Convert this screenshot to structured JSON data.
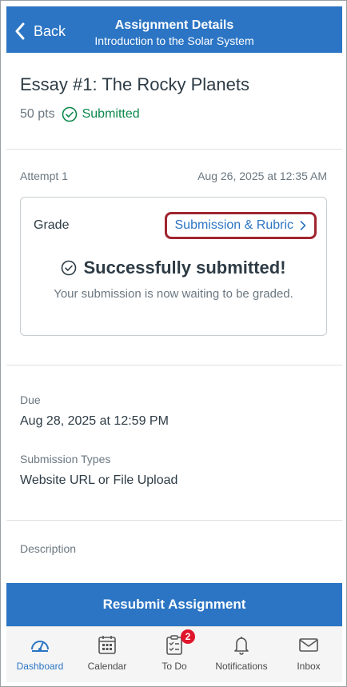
{
  "header": {
    "back_label": "Back",
    "title": "Assignment Details",
    "subtitle": "Introduction to the Solar System"
  },
  "assignment": {
    "title": "Essay #1: The Rocky Planets",
    "points": "50 pts",
    "status": "Submitted"
  },
  "attempt": {
    "label": "Attempt 1",
    "date": "Aug 26, 2025 at 12:35 AM"
  },
  "grade_card": {
    "label": "Grade",
    "link": "Submission & Rubric",
    "success_title": "Successfully submitted!",
    "success_message": "Your submission is now waiting to be graded."
  },
  "details": {
    "due_label": "Due",
    "due_value": "Aug 28, 2025 at 12:59 PM",
    "types_label": "Submission Types",
    "types_value": "Website URL or File Upload",
    "description_label": "Description"
  },
  "resubmit_label": "Resubmit Assignment",
  "tabs": [
    {
      "label": "Dashboard",
      "icon": "dashboard-icon",
      "active": true
    },
    {
      "label": "Calendar",
      "icon": "calendar-icon"
    },
    {
      "label": "To Do",
      "icon": "todo-icon",
      "badge": "2"
    },
    {
      "label": "Notifications",
      "icon": "bell-icon"
    },
    {
      "label": "Inbox",
      "icon": "inbox-icon"
    }
  ],
  "colors": {
    "brand": "#2c75c4",
    "success": "#0b874b",
    "highlight": "#a0252f",
    "badge": "#e0162b"
  }
}
